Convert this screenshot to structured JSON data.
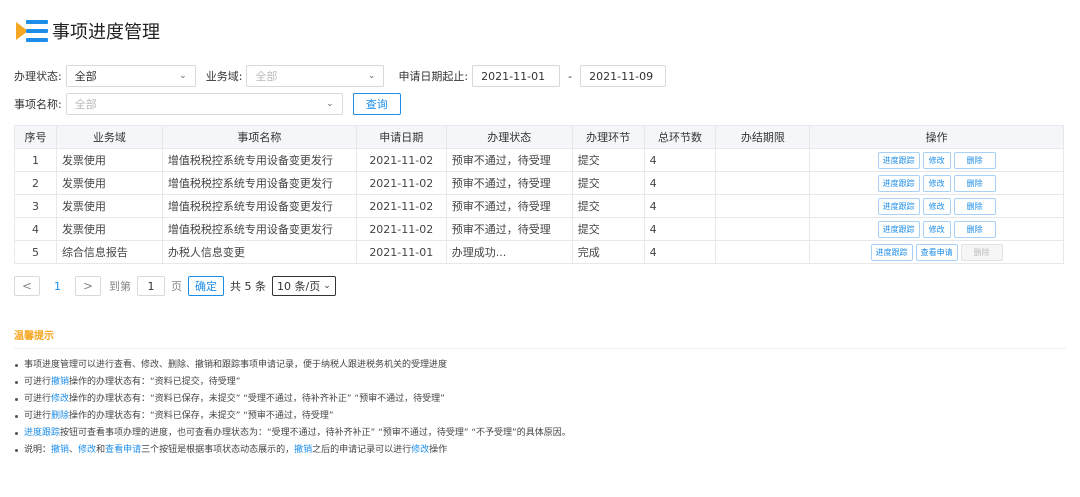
{
  "header": {
    "title": "事项进度管理"
  },
  "filters": {
    "status_label": "办理状态:",
    "status_value": "全部",
    "domain_label": "业务域:",
    "domain_placeholder": "全部",
    "date_label": "申请日期起止:",
    "date_start": "2021-11-01",
    "date_sep": "-",
    "date_end": "2021-11-09",
    "item_label": "事项名称:",
    "item_placeholder": "全部",
    "query_label": "查询"
  },
  "table": {
    "headers": [
      "序号",
      "业务域",
      "事项名称",
      "申请日期",
      "办理状态",
      "办理环节",
      "总环节数",
      "办结期限",
      "操作"
    ],
    "rows": [
      {
        "no": "1",
        "domain": "发票使用",
        "name": "增值税税控系统专用设备变更发行",
        "date": "2021-11-02",
        "status": "预审不通过，待受理",
        "stage": "提交",
        "total": "4",
        "deadline": "",
        "ops": [
          "进度跟踪",
          "修改",
          "删除"
        ]
      },
      {
        "no": "2",
        "domain": "发票使用",
        "name": "增值税税控系统专用设备变更发行",
        "date": "2021-11-02",
        "status": "预审不通过，待受理",
        "stage": "提交",
        "total": "4",
        "deadline": "",
        "ops": [
          "进度跟踪",
          "修改",
          "删除"
        ]
      },
      {
        "no": "3",
        "domain": "发票使用",
        "name": "增值税税控系统专用设备变更发行",
        "date": "2021-11-02",
        "status": "预审不通过，待受理",
        "stage": "提交",
        "total": "4",
        "deadline": "",
        "ops": [
          "进度跟踪",
          "修改",
          "删除"
        ]
      },
      {
        "no": "4",
        "domain": "发票使用",
        "name": "增值税税控系统专用设备变更发行",
        "date": "2021-11-02",
        "status": "预审不通过，待受理",
        "stage": "提交",
        "total": "4",
        "deadline": "",
        "ops": [
          "进度跟踪",
          "修改",
          "删除"
        ]
      },
      {
        "no": "5",
        "domain": "综合信息报告",
        "name": "办税人信息变更",
        "date": "2021-11-01",
        "status": "办理成功...",
        "stage": "完成",
        "total": "4",
        "deadline": "",
        "ops": [
          "进度跟踪",
          "查看申请",
          "删除"
        ]
      }
    ]
  },
  "pager": {
    "prev": "<",
    "page": "1",
    "next": ">",
    "goto_label": "到第",
    "goto_value": "1",
    "page_unit": "页",
    "confirm": "确定",
    "total": "共 5 条",
    "page_size": "10 条/页"
  },
  "tips": {
    "title": "温馨提示",
    "line1": "事项进度管理可以进行查看、修改、删除、撤销和跟踪事项申请记录，便于纳税人跟进税务机关的受理进度",
    "line2_a": "可进行",
    "line2_hl": "撤销",
    "line2_b": "操作的办理状态有：“资料已提交，待受理”",
    "line3_a": "可进行",
    "line3_hl": "修改",
    "line3_b": "操作的办理状态有：“资料已保存，未提交”  “受理不通过，待补齐补正”  “预审不通过，待受理”",
    "line4_a": "可进行",
    "line4_hl": "删除",
    "line4_b": "操作的办理状态有：“资料已保存，未提交”  “预审不通过，待受理”",
    "line5_hl": "进度跟踪",
    "line5_b": "按钮可查看事项办理的进度，也可查看办理状态为：“受理不通过，待补齐补正”  “预审不通过，待受理”  “不予受理”的具体原因。",
    "line6_a": "说明：",
    "line6_hl1": "撤销",
    "line6_sep1": "、",
    "line6_hl2": "修改",
    "line6_and": "和",
    "line6_hl3": "查看申请",
    "line6_b": "三个按钮是根据事项状态动态展示的，",
    "line6_hl4": "撤销",
    "line6_c": "之后的申请记录可以进行",
    "line6_hl5": "修改",
    "line6_d": "操作"
  },
  "colors": {
    "accent": "#1c8de8",
    "tip_title": "#f5a623"
  }
}
